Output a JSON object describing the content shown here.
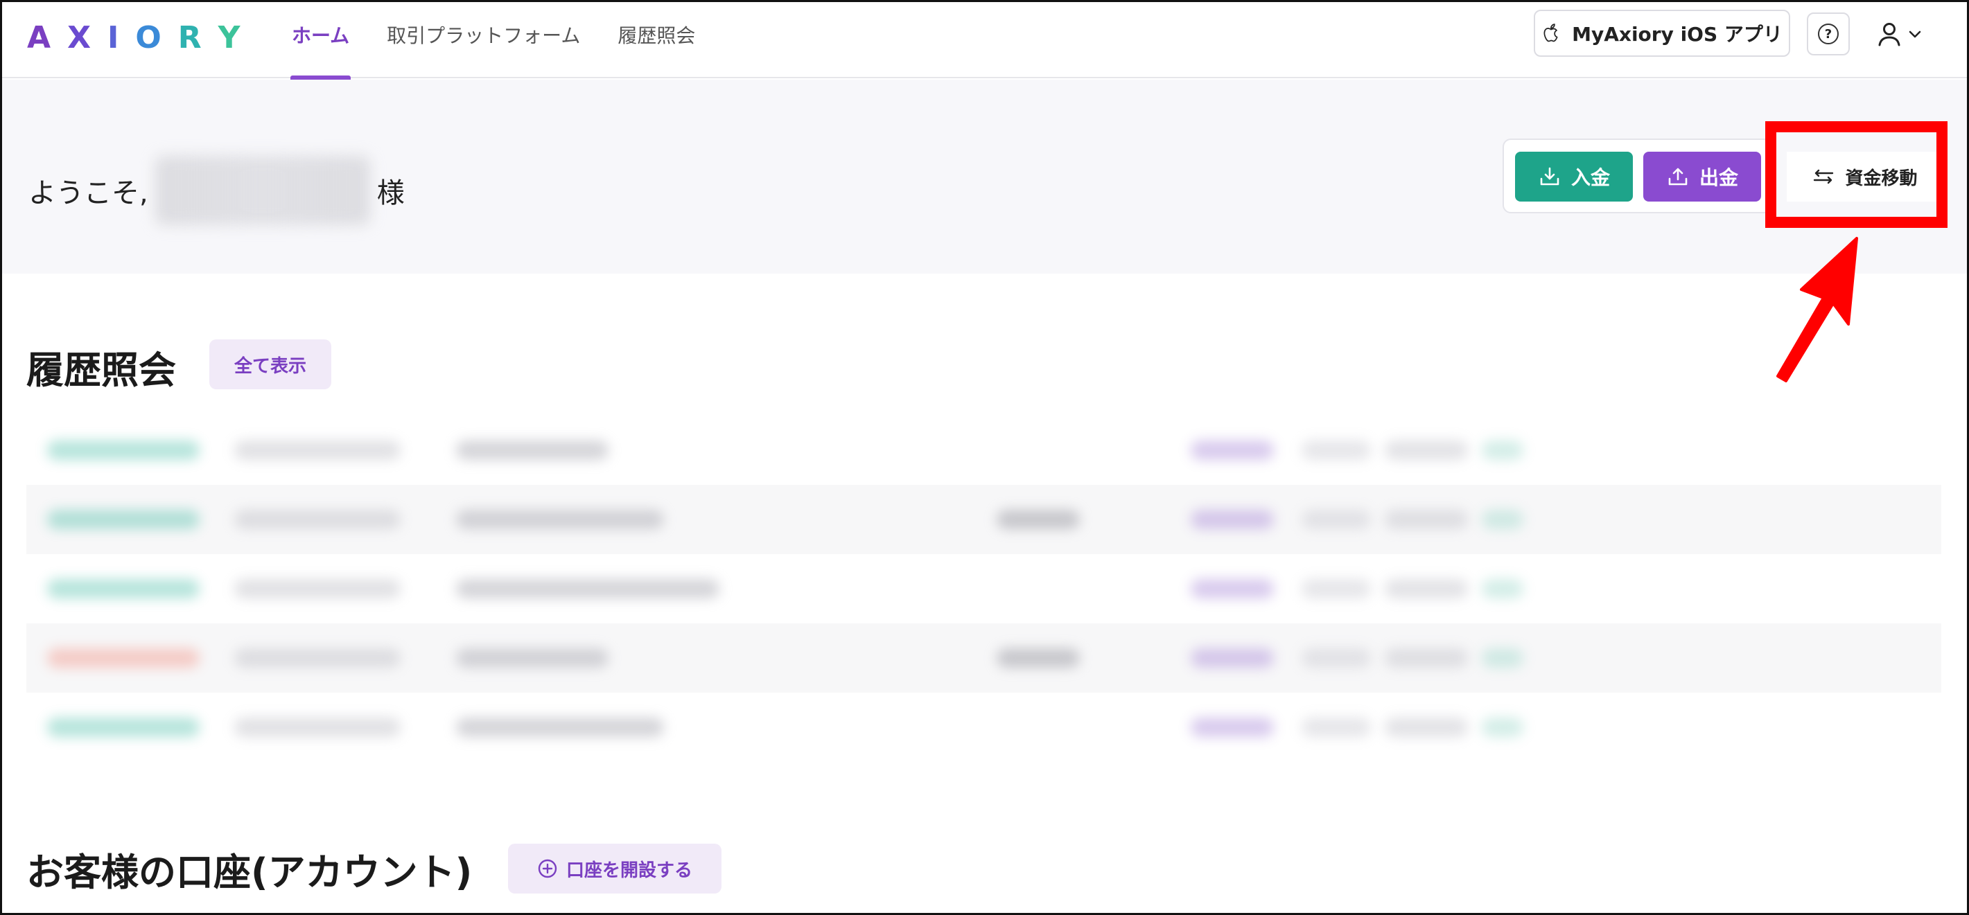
{
  "logo": {
    "letters": [
      "A",
      "X",
      "I",
      "O",
      "R",
      "Y"
    ],
    "colors": [
      "#7a3fc1",
      "#6a4bd0",
      "#5a63d6",
      "#3b8ad8",
      "#2fb2b0",
      "#3cc39a"
    ]
  },
  "nav": {
    "items": [
      {
        "label": "ホーム",
        "active": true
      },
      {
        "label": "取引プラットフォーム",
        "active": false
      },
      {
        "label": "履歴照会",
        "active": false
      }
    ]
  },
  "header": {
    "ios_app_label": "MyAxiory iOS アプリ",
    "help_label": "?"
  },
  "welcome": {
    "prefix": "ようこそ,",
    "suffix": "様"
  },
  "actions": {
    "deposit_label": "入金",
    "withdraw_label": "出金",
    "transfer_label": "資金移動"
  },
  "history": {
    "title": "履歴照会",
    "show_all_label": "全て表示",
    "rows": [
      {
        "status_color": "#2fb39a",
        "highlight": false,
        "has_amount": false
      },
      {
        "status_color": "#2fb39a",
        "highlight": true,
        "has_amount": true
      },
      {
        "status_color": "#2fb39a",
        "highlight": false,
        "has_amount": false
      },
      {
        "status_color": "#f07a6a",
        "highlight": true,
        "has_amount": true
      },
      {
        "status_color": "#2fb39a",
        "highlight": false,
        "has_amount": false
      }
    ]
  },
  "accounts": {
    "title": "お客様の口座(アカウント)",
    "open_account_label": "口座を開設する"
  },
  "colors": {
    "accent_purple": "#8a4bd0",
    "deposit_green": "#1ea48a",
    "annotation_red": "#ff0000"
  }
}
